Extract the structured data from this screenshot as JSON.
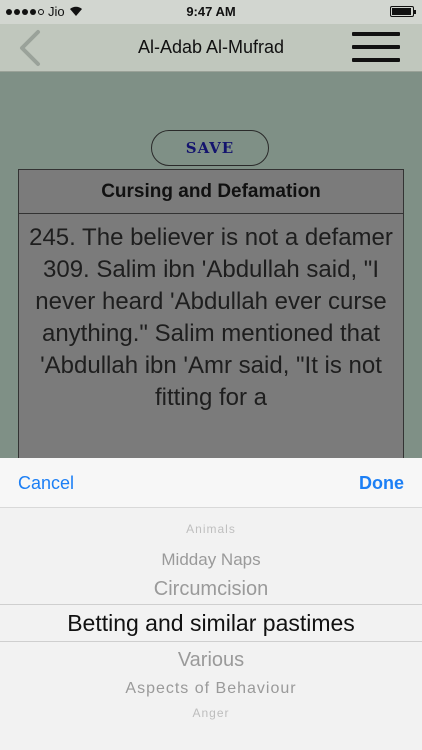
{
  "status_bar": {
    "carrier": "Jio",
    "time": "9:47 AM"
  },
  "nav": {
    "title": "Al-Adab Al-Mufrad",
    "back_icon": "chevron-left-icon",
    "menu_icon": "hamburger-menu-icon"
  },
  "save_label": "SAVE",
  "card": {
    "title": "Cursing and Defamation",
    "body": "245. The believer is not a defamer 309. Salim ibn 'Abdullah said, \"I never heard 'Abdullah ever curse anything.\" Salim mentioned that 'Abdullah ibn 'Amr said, \"It is not fitting for a"
  },
  "picker": {
    "cancel_label": "Cancel",
    "done_label": "Done",
    "options": [
      "Animals",
      "Midday Naps",
      "Circumcision",
      "Betting and similar pastimes",
      "Various",
      "Aspects of Behaviour",
      "Anger"
    ],
    "selected": "Betting and similar pastimes"
  },
  "colors": {
    "accent": "#1c7ff5",
    "save_text": "#14146e",
    "content_bg": "#7f9086"
  }
}
